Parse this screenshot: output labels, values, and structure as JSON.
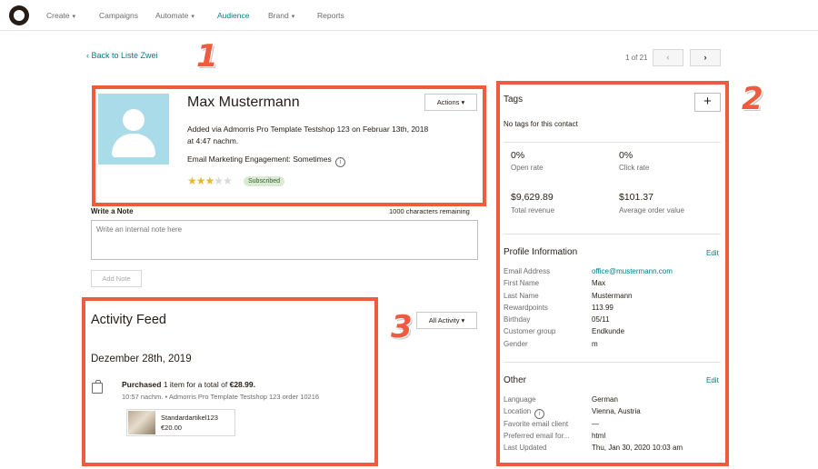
{
  "nav": {
    "items": [
      {
        "label": "Create",
        "caret": true
      },
      {
        "label": "Campaigns",
        "caret": false
      },
      {
        "label": "Automate",
        "caret": true
      },
      {
        "label": "Audience",
        "caret": false,
        "active": true
      },
      {
        "label": "Brand",
        "caret": true
      },
      {
        "label": "Reports",
        "caret": false
      }
    ],
    "logo_icon": "freddie-logo-icon"
  },
  "back_link": "Back to Liste Zwei",
  "pager": {
    "text": "1 of 21",
    "prev": "‹",
    "next": "›"
  },
  "annotations": {
    "one": "1",
    "two": "2",
    "three": "3",
    "color": "#ef5b3f"
  },
  "contact": {
    "name": "Max Mustermann",
    "actions_label": "Actions",
    "added_via": "Added via Admorris Pro Template Testshop 123 on Februar 13th, 2018 at 4:47 nachm.",
    "engagement": "Email Marketing Engagement: Sometimes",
    "rating": 3,
    "rating_max": 5,
    "status_badge": "Subscribed"
  },
  "note": {
    "label": "Write a Note",
    "remaining": "1000 characters remaining",
    "placeholder": "Write an internal note here",
    "add_button": "Add Note"
  },
  "activity": {
    "title": "Activity Feed",
    "filter_label": "All Activity",
    "date": "Dezember 28th, 2019",
    "event": {
      "action": "Purchased",
      "text_middle": " 1 item for a total of ",
      "total": "€28.99.",
      "meta": "10:57 nachm. • Admorris Pro Template Testshop 123 order 10216",
      "product_name": "Standardartikel123",
      "product_price": "€20.00"
    }
  },
  "tags": {
    "title": "Tags",
    "add": "+",
    "empty": "No tags for this contact"
  },
  "stats": [
    {
      "value": "0%",
      "label": "Open rate"
    },
    {
      "value": "0%",
      "label": "Click rate"
    },
    {
      "value": "$9,629.89",
      "label": "Total revenue"
    },
    {
      "value": "$101.37",
      "label": "Average order value"
    }
  ],
  "profile": {
    "title": "Profile Information",
    "edit": "Edit",
    "fields": [
      {
        "label": "Email Address",
        "value": "office@mustermann.com"
      },
      {
        "label": "First Name",
        "value": "Max"
      },
      {
        "label": "Last Name",
        "value": "Mustermann"
      },
      {
        "label": "Rewardpoints",
        "value": "113.99"
      },
      {
        "label": "Birthday",
        "value": "05/11"
      },
      {
        "label": "Customer group",
        "value": "Endkunde"
      },
      {
        "label": "Gender",
        "value": "m"
      }
    ]
  },
  "other": {
    "title": "Other",
    "edit": "Edit",
    "fields": [
      {
        "label": "Language",
        "value": "German"
      },
      {
        "label": "Location",
        "value": "Vienna, Austria"
      },
      {
        "label": "Favorite email client",
        "value": "—"
      },
      {
        "label": "Preferred email for...",
        "value": "html"
      },
      {
        "label": "Last Updated",
        "value": "Thu, Jan 30, 2020 10:03 am"
      }
    ]
  }
}
